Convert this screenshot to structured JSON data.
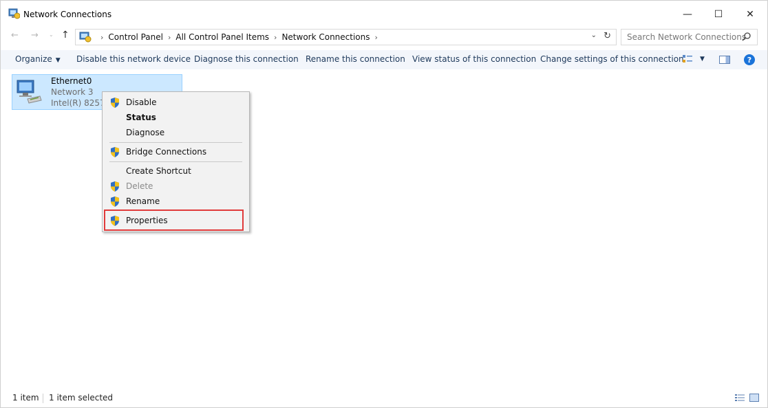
{
  "window": {
    "title": "Network Connections",
    "minimize_glyph": "—",
    "maximize_glyph": "☐",
    "close_glyph": "✕"
  },
  "address_bar": {
    "back_glyph": "←",
    "forward_glyph": "→",
    "recent_glyph": "⌄",
    "up_glyph": "↑",
    "crumbs": [
      "Control Panel",
      "All Control Panel Items",
      "Network Connections"
    ],
    "separator": "›",
    "dropdown_glyph": "⌄",
    "refresh_glyph": "↻"
  },
  "search": {
    "placeholder": "Search Network Connections",
    "icon": "search-icon"
  },
  "command_bar": {
    "organize": "Organize",
    "organize_caret": "▼",
    "disable": "Disable this network device",
    "diagnose": "Diagnose this connection",
    "rename": "Rename this connection",
    "view_status": "View status of this connection",
    "change_settings": "Change settings of this connection",
    "view_caret": "▼",
    "help": "?"
  },
  "item": {
    "name": "Ethernet0",
    "network": "Network 3",
    "adapter": "Intel(R) 82574L Gigabit Network Connection"
  },
  "context_menu": {
    "items": [
      {
        "label": "Disable",
        "shield": true,
        "bold": false,
        "disabled": false
      },
      {
        "label": "Status",
        "shield": false,
        "bold": true,
        "disabled": false
      },
      {
        "label": "Diagnose",
        "shield": false,
        "bold": false,
        "disabled": false
      },
      {
        "label": "Bridge Connections",
        "shield": true,
        "bold": false,
        "disabled": false
      },
      {
        "label": "Create Shortcut",
        "shield": false,
        "bold": false,
        "disabled": false
      },
      {
        "label": "Delete",
        "shield": true,
        "bold": false,
        "disabled": true
      },
      {
        "label": "Rename",
        "shield": true,
        "bold": false,
        "disabled": false
      },
      {
        "label": "Properties",
        "shield": true,
        "bold": false,
        "disabled": false
      }
    ],
    "highlighted": "Properties",
    "highlight_color": "#e03a3a"
  },
  "status_bar": {
    "item_count": "1 item",
    "selected": "1 item selected"
  },
  "colors": {
    "selection_bg": "#cce8ff",
    "command_text": "#1e395b",
    "help_blue": "#1a73d9"
  }
}
